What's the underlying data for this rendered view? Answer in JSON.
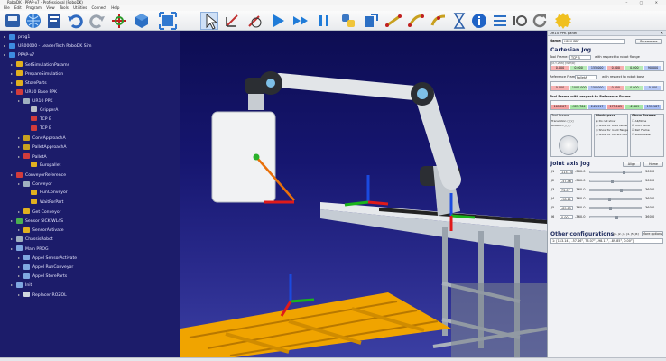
{
  "window": {
    "title": "RoboDK - PPAP-v7 - Professional (RoboDK)"
  },
  "menu": [
    "File",
    "Edit",
    "Program",
    "View",
    "Tools",
    "Utilities",
    "Connect",
    "Help"
  ],
  "toolbar": {
    "icons": [
      "save-icon",
      "globe-icon",
      "add-program-icon",
      "undo-icon",
      "redo-icon",
      "add-target-icon",
      "cube-icon",
      "fit-all-icon",
      "select-icon",
      "move-frame-icon",
      "rotate-frame-icon",
      "run-icon",
      "fast-forward-icon",
      "pause-icon",
      "python-icon",
      "export-icon",
      "linear-move-icon",
      "joint-move-icon",
      "circular-move-icon",
      "wait-icon",
      "info-icon",
      "program-list-icon",
      "io-icon",
      "refresh-icon",
      "settings-gear-icon"
    ]
  },
  "tree": {
    "items": [
      {
        "label": "prog1",
        "level": 0,
        "icon": "station",
        "color": "#3d8be0"
      },
      {
        "label": "UR00000 - LeaderTech RoboDK Sim",
        "level": 0,
        "icon": "station",
        "color": "#3d8be0"
      },
      {
        "label": "PPAP-v7",
        "level": 0,
        "icon": "station",
        "color": "#3d8be0"
      },
      {
        "label": "SetSimulationParams",
        "level": 1,
        "icon": "python",
        "color": "#e0b020"
      },
      {
        "label": "PrepareSimulation",
        "level": 1,
        "icon": "python",
        "color": "#e0b020"
      },
      {
        "label": "StoreParts",
        "level": 1,
        "icon": "python",
        "color": "#e0b020"
      },
      {
        "label": "UR10 Base PPK",
        "level": 1,
        "icon": "frame",
        "color": "#d23c3c"
      },
      {
        "label": "UR10 PPK",
        "level": 2,
        "icon": "robot",
        "color": "#9fb0c0"
      },
      {
        "label": "GripperA",
        "level": 3,
        "icon": "tool",
        "color": "#b9bec6"
      },
      {
        "label": "TCP B",
        "level": 3,
        "icon": "target",
        "color": "#d23c3c"
      },
      {
        "label": "TCP B",
        "level": 3,
        "icon": "target",
        "color": "#d23c3c"
      },
      {
        "label": "ConvApproachA",
        "level": 2,
        "icon": "target",
        "color": "#c8a020"
      },
      {
        "label": "PalletApproachA",
        "level": 2,
        "icon": "target",
        "color": "#c8a020"
      },
      {
        "label": "PalletA",
        "level": 2,
        "icon": "frame",
        "color": "#d23c3c"
      },
      {
        "label": "Europallet",
        "level": 3,
        "icon": "object",
        "color": "#e0b020"
      },
      {
        "label": "ConveyorReference",
        "level": 1,
        "icon": "frame",
        "color": "#d23c3c"
      },
      {
        "label": "Conveyor",
        "level": 2,
        "icon": "object",
        "color": "#9fb0c0"
      },
      {
        "label": "RunConveyor",
        "level": 3,
        "icon": "program",
        "color": "#e0b020"
      },
      {
        "label": "WaitForPart",
        "level": 3,
        "icon": "program",
        "color": "#e0b020"
      },
      {
        "label": "Get Conveyor",
        "level": 2,
        "icon": "program",
        "color": "#e0b020"
      },
      {
        "label": "Sensor SICK WL4S",
        "level": 1,
        "icon": "object",
        "color": "#4bb050"
      },
      {
        "label": "SensorActivate",
        "level": 2,
        "icon": "program",
        "color": "#e0b020"
      },
      {
        "label": "ChassisRobot",
        "level": 1,
        "icon": "object",
        "color": "#9fb0c0"
      },
      {
        "label": "Main PROG",
        "level": 1,
        "icon": "program",
        "color": "#7fa7e0"
      },
      {
        "label": "Appel SensorActivate",
        "level": 2,
        "icon": "program",
        "color": "#7fa7e0"
      },
      {
        "label": "Appel RunConveyor",
        "level": 2,
        "icon": "program",
        "color": "#7fa7e0"
      },
      {
        "label": "Appel StoreParts",
        "level": 2,
        "icon": "program",
        "color": "#7fa7e0"
      },
      {
        "label": "Init",
        "level": 1,
        "icon": "program",
        "color": "#7fa7e0"
      },
      {
        "label": "Replacer ROZOL",
        "level": 2,
        "icon": "reset",
        "color": "#cfd6de"
      }
    ]
  },
  "panel": {
    "title": "UR10 PPK panel",
    "name_label": "Name:",
    "name_value": "UR10 PPK",
    "params_button": "Parameters",
    "cartesian_title": "Cartesian Jog",
    "tool_frame_label": "Tool Frame:",
    "tool_frame_value": "TCP B",
    "tool_frame_note": "with respect to robot flange",
    "tool_values": [
      "0.000",
      "0.000",
      "155.000",
      "0.000",
      "0.000",
      "90.000"
    ],
    "ref_frame_label": "Reference Frame:",
    "ref_frame_value": "PalletA",
    "ref_frame_note": "with respect to robot base",
    "ref_values": [
      "0.000",
      "-1000.000",
      "150.000",
      "0.000",
      "0.000",
      "0.000"
    ],
    "tcp_label": "Tool Frame with respect to Reference Frame",
    "tcp_values": [
      "101.207",
      "-925.764",
      "241.917",
      "175.165",
      "-2.409",
      "137.187"
    ],
    "jog_tool_label": "Tool Frame",
    "workspace_label": "Workspace",
    "workspace_options": [
      "Do not show",
      "Show for tools center",
      "Show for robot flange",
      "Show for current tool"
    ],
    "show_frames_label": "Show Frames",
    "show_frames_options": [
      "All/None",
      "Tool Frame",
      "Ref. Frame",
      "Robot Base"
    ],
    "joints_title": "Joint axis jog",
    "align_button": "Align",
    "home_button": "Home",
    "joints": [
      {
        "name": "J1",
        "min": "-360.0",
        "value": "113.14",
        "max": "360.0",
        "fraction": 0.66
      },
      {
        "name": "J2",
        "min": "-360.0",
        "value": "-57.46",
        "max": "360.0",
        "fraction": 0.42
      },
      {
        "name": "J3",
        "min": "-360.0",
        "value": "73.07",
        "max": "360.0",
        "fraction": 0.6
      },
      {
        "name": "J4",
        "min": "-360.0",
        "value": "-98.11",
        "max": "360.0",
        "fraction": 0.36
      },
      {
        "name": "J5",
        "min": "-360.0",
        "value": "-89.85",
        "max": "360.0",
        "fraction": 0.38
      },
      {
        "name": "J6",
        "min": "-360.0",
        "value": "0.00",
        "max": "360.0",
        "fraction": 0.5
      }
    ],
    "other_title": "Other configurations",
    "other_sub": "[J1, J2, J3, J4, J5, J6]",
    "more_options": "More options",
    "config_value": "1: [113.14°, -57.46°, 73.07°, -98.11°, -89.85°, 0.00°]"
  },
  "colors": {
    "viewport_top": "#0d0d52",
    "viewport_bottom": "#3b3fa3",
    "tree_bg": "#1c1c6a",
    "x_axis": "#e01a1a",
    "y_axis": "#1ab41a",
    "z_axis": "#1a4ae0",
    "pallet": "#f0a400"
  }
}
